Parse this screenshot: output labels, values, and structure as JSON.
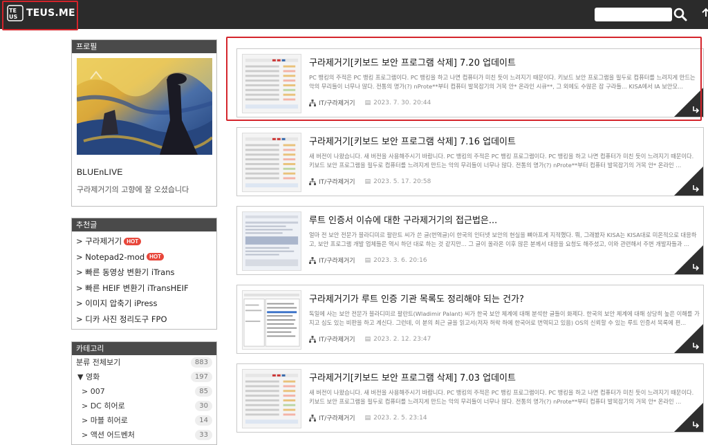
{
  "header": {
    "logo_text": "TEUS.ME",
    "logo_mark_letters": "TEUS",
    "search_placeholder": "",
    "search_icon": "search-icon"
  },
  "sidebar": {
    "profile": {
      "title": "프로필",
      "name": "BLUEnLIVE",
      "description": "구라제거기의 고향에 잘 오셨습니다"
    },
    "recommended": {
      "title": "추천글",
      "items": [
        {
          "label": "> 구라제거기",
          "badge": "HOT"
        },
        {
          "label": "> Notepad2-mod",
          "badge": "HOT"
        },
        {
          "label": "> 빠른 동영상 변환기 iTrans",
          "badge": ""
        },
        {
          "label": "> 빠른 HEIF 변환기 iTransHEIF",
          "badge": ""
        },
        {
          "label": "> 이미지 압축기 iPress",
          "badge": ""
        },
        {
          "label": "> 디카 사진 정리도구 FPO",
          "badge": ""
        }
      ]
    },
    "categories": {
      "title": "카테고리",
      "items": [
        {
          "label": "분류 전체보기",
          "count": "883"
        },
        {
          "label": "▼ 영화",
          "count": "197"
        },
        {
          "label": "> 007",
          "count": "85"
        },
        {
          "label": "> DC 히어로",
          "count": "30"
        },
        {
          "label": "> 마블 히어로",
          "count": "14"
        },
        {
          "label": "> 액션 어드벤처",
          "count": "33"
        }
      ]
    }
  },
  "posts": [
    {
      "title": "구라제거기[키보드 보안 프로그램 삭제] 7.20 업데이트",
      "excerpt": "PC 뱅킹의 주적은 PC 뱅킹 프로그램이다. PC 뱅킹을 하고 나면 컴퓨터가 미친 듯이 느려지기 때문이다. 키보드 보안 프로그램을 필두로 컴퓨터를 느려지게 만드는 악의 무리들이 너무나 많다. 전통의 명가(?) nProte**부터 컴퓨터 발목잡기의 거목 안* 온라인 시큐**, 그 외에도 수많은 잡 구라들... KISA에서 IA 보안모...",
      "category": "IT/구라제거기",
      "date": "2023. 7. 30. 20:44"
    },
    {
      "title": "구라제거기[키보드 보안 프로그램 삭제] 7.16 업데이트",
      "excerpt": "새 버전이 나왔습니다. 새 버전을 사용해주시기 바랍니다. PC 뱅킹의 주적은 PC 뱅킹 프로그램이다. PC 뱅킹을 하고 나면 컴퓨터가 미친 듯이 느려지기 때문이다. 키보드 보안 프로그램을 필두로 컴퓨터를 느려지게 만드는 악의 무리들이 너무나 많다. 전통의 명가(?) nProte**부터 컴퓨터 발목잡기의 거목 안* 온라인 ...",
      "category": "IT/구라제거기",
      "date": "2023. 5. 17. 20:58"
    },
    {
      "title": "루트 인증서 이슈에 대한 구라제거기의 접근법은...",
      "excerpt": "얼마 전 보안 전문가 블라디미르 팔란트 씨가 쓴 글(번역글)이 한국의 인터넷 보안의 현실을 뼈아프게 지적했다. 뭐, 그래봤자 KISA는 KISA대로 미온적으로 대응하고, 보안 프로그램 개발 업체들은 역시 하던 대로 하는 것 같지만... 그 글이 올라온 이후 많은 분께서 대응을 요청도 해주셨고, 이와 관련해서 주변 개발자들과 ...",
      "category": "IT/구라제거기",
      "date": "2023. 3. 6. 20:16"
    },
    {
      "title": "구라제거기가 루트 인증 기관 목록도 정리해야 되는 건가?",
      "excerpt": "독일에 사는 보안 전문가 블라디미르 팔란트(Wladimir Palant) 씨가 한국 보안 체계에 대해 분석한 글들이 화제다. 한국의 보안 체계에 대해 상당히 높은 이해를 가지고 심도 있는 비판을 하고 계신다. 그런데, 이 분의 최근 글을 읽고서(저자 허락 하에 한국어로 번역되고 있음) OS의 신뢰할 수 있는 루트 인증서 목록에 편...",
      "category": "IT/구라제거기",
      "date": "2023. 2. 12. 23:47"
    },
    {
      "title": "구라제거기[키보드 보안 프로그램 삭제] 7.03 업데이트",
      "excerpt": "새 버전이 나왔습니다. 새 버전을 사용해주시기 바랍니다. PC 뱅킹의 주적은 PC 뱅킹 프로그램이다. PC 뱅킹을 하고 나면 컴퓨터가 미친 듯이 느려지기 때문이다. 키보드 보안 프로그램을 필두로 컴퓨터를 느려지게 만드는 악의 무리들이 너무나 많다. 전통의 명가(?) nProte**부터 컴퓨터 발목잡기의 거목 안* 온라인 ...",
      "category": "IT/구라제거기",
      "date": "2023. 2. 5. 23:14"
    }
  ],
  "colors": {
    "header_bg": "#2b2b2b",
    "highlight": "#d4242b",
    "hot_badge": "#e8473b",
    "widget_title_bg": "#4a4a4a"
  }
}
